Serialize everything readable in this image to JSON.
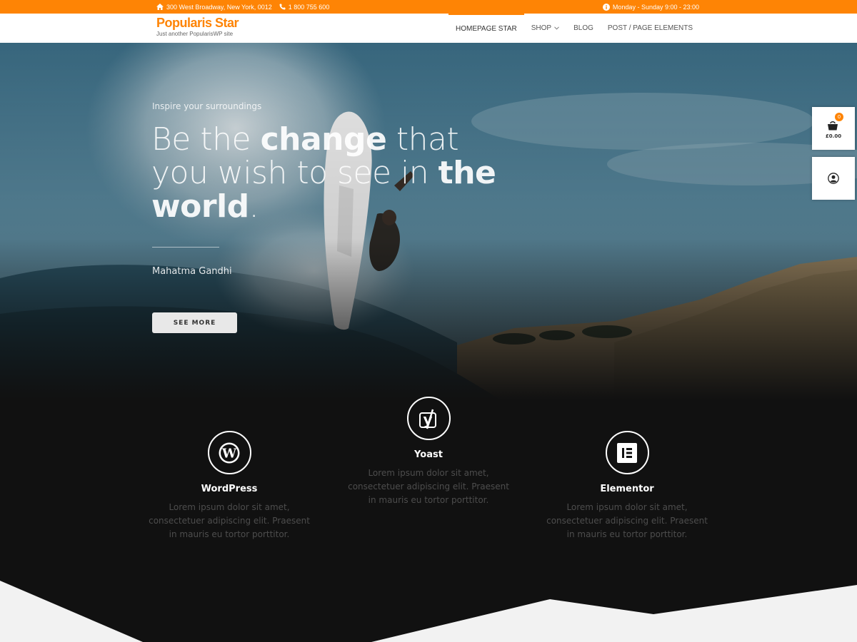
{
  "topbar": {
    "address": "300 West Broadway, New York, 0012",
    "phone": "1 800 755 600",
    "hours": "Monday - Sunday 9:00 - 23:00"
  },
  "header": {
    "site_title": "Popularis Star",
    "site_description": "Just another PopularisWP site",
    "nav": [
      {
        "label": "Homepage Star",
        "active": true
      },
      {
        "label": "Shop",
        "has_submenu": true
      },
      {
        "label": "Blog"
      },
      {
        "label": "Post / Page Elements"
      }
    ]
  },
  "hero": {
    "eyebrow": "Inspire your surroundings",
    "heading_parts": [
      "Be the ",
      "change",
      " that you wish to see in ",
      "the world",
      "."
    ],
    "author": "Mahatma Gandhi",
    "button_label": "SEE MORE"
  },
  "side": {
    "cart_count": "0",
    "cart_total": "£0.00",
    "icons": [
      "shopping-bag-icon",
      "user-icon"
    ]
  },
  "features": [
    {
      "title": "WordPress",
      "icon": "wordpress-icon",
      "text": "Lorem ipsum dolor sit amet, consectetuer adipiscing elit. Praesent in mauris eu tortor porttitor."
    },
    {
      "title": "Yoast",
      "icon": "yoast-icon",
      "text": "Lorem ipsum dolor sit amet, consectetuer adipiscing elit. Praesent in mauris eu tortor porttitor."
    },
    {
      "title": "Elementor",
      "icon": "elementor-icon",
      "text": "Lorem ipsum dolor sit amet, consectetuer adipiscing elit. Praesent in mauris eu tortor porttitor."
    }
  ],
  "colors": {
    "accent": "#fe8405",
    "dark": "#111111",
    "light": "#f2f2f2"
  }
}
